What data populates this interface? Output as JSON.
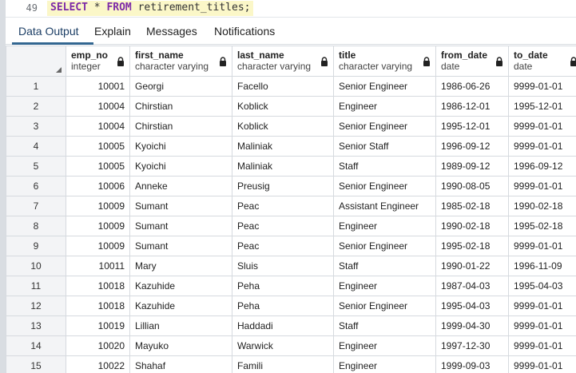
{
  "editor": {
    "line_number": "49",
    "kw_select": "SELECT",
    "star": " * ",
    "kw_from": "FROM",
    "rest": " retirement_titles;"
  },
  "tabs": [
    {
      "label": "Data Output",
      "active": true
    },
    {
      "label": "Explain",
      "active": false
    },
    {
      "label": "Messages",
      "active": false
    },
    {
      "label": "Notifications",
      "active": false
    }
  ],
  "columns": [
    {
      "name": "emp_no",
      "type": "integer"
    },
    {
      "name": "first_name",
      "type": "character varying"
    },
    {
      "name": "last_name",
      "type": "character varying"
    },
    {
      "name": "title",
      "type": "character varying"
    },
    {
      "name": "from_date",
      "type": "date"
    },
    {
      "name": "to_date",
      "type": "date"
    }
  ],
  "rows": [
    [
      "1",
      "10001",
      "Georgi",
      "Facello",
      "Senior Engineer",
      "1986-06-26",
      "9999-01-01"
    ],
    [
      "2",
      "10004",
      "Chirstian",
      "Koblick",
      "Engineer",
      "1986-12-01",
      "1995-12-01"
    ],
    [
      "3",
      "10004",
      "Chirstian",
      "Koblick",
      "Senior Engineer",
      "1995-12-01",
      "9999-01-01"
    ],
    [
      "4",
      "10005",
      "Kyoichi",
      "Maliniak",
      "Senior Staff",
      "1996-09-12",
      "9999-01-01"
    ],
    [
      "5",
      "10005",
      "Kyoichi",
      "Maliniak",
      "Staff",
      "1989-09-12",
      "1996-09-12"
    ],
    [
      "6",
      "10006",
      "Anneke",
      "Preusig",
      "Senior Engineer",
      "1990-08-05",
      "9999-01-01"
    ],
    [
      "7",
      "10009",
      "Sumant",
      "Peac",
      "Assistant Engineer",
      "1985-02-18",
      "1990-02-18"
    ],
    [
      "8",
      "10009",
      "Sumant",
      "Peac",
      "Engineer",
      "1990-02-18",
      "1995-02-18"
    ],
    [
      "9",
      "10009",
      "Sumant",
      "Peac",
      "Senior Engineer",
      "1995-02-18",
      "9999-01-01"
    ],
    [
      "10",
      "10011",
      "Mary",
      "Sluis",
      "Staff",
      "1990-01-22",
      "1996-11-09"
    ],
    [
      "11",
      "10018",
      "Kazuhide",
      "Peha",
      "Engineer",
      "1987-04-03",
      "1995-04-03"
    ],
    [
      "12",
      "10018",
      "Kazuhide",
      "Peha",
      "Senior Engineer",
      "1995-04-03",
      "9999-01-01"
    ],
    [
      "13",
      "10019",
      "Lillian",
      "Haddadi",
      "Staff",
      "1999-04-30",
      "9999-01-01"
    ],
    [
      "14",
      "10020",
      "Mayuko",
      "Warwick",
      "Engineer",
      "1997-12-30",
      "9999-01-01"
    ],
    [
      "15",
      "10022",
      "Shahaf",
      "Famili",
      "Engineer",
      "1999-09-03",
      "9999-01-01"
    ]
  ]
}
